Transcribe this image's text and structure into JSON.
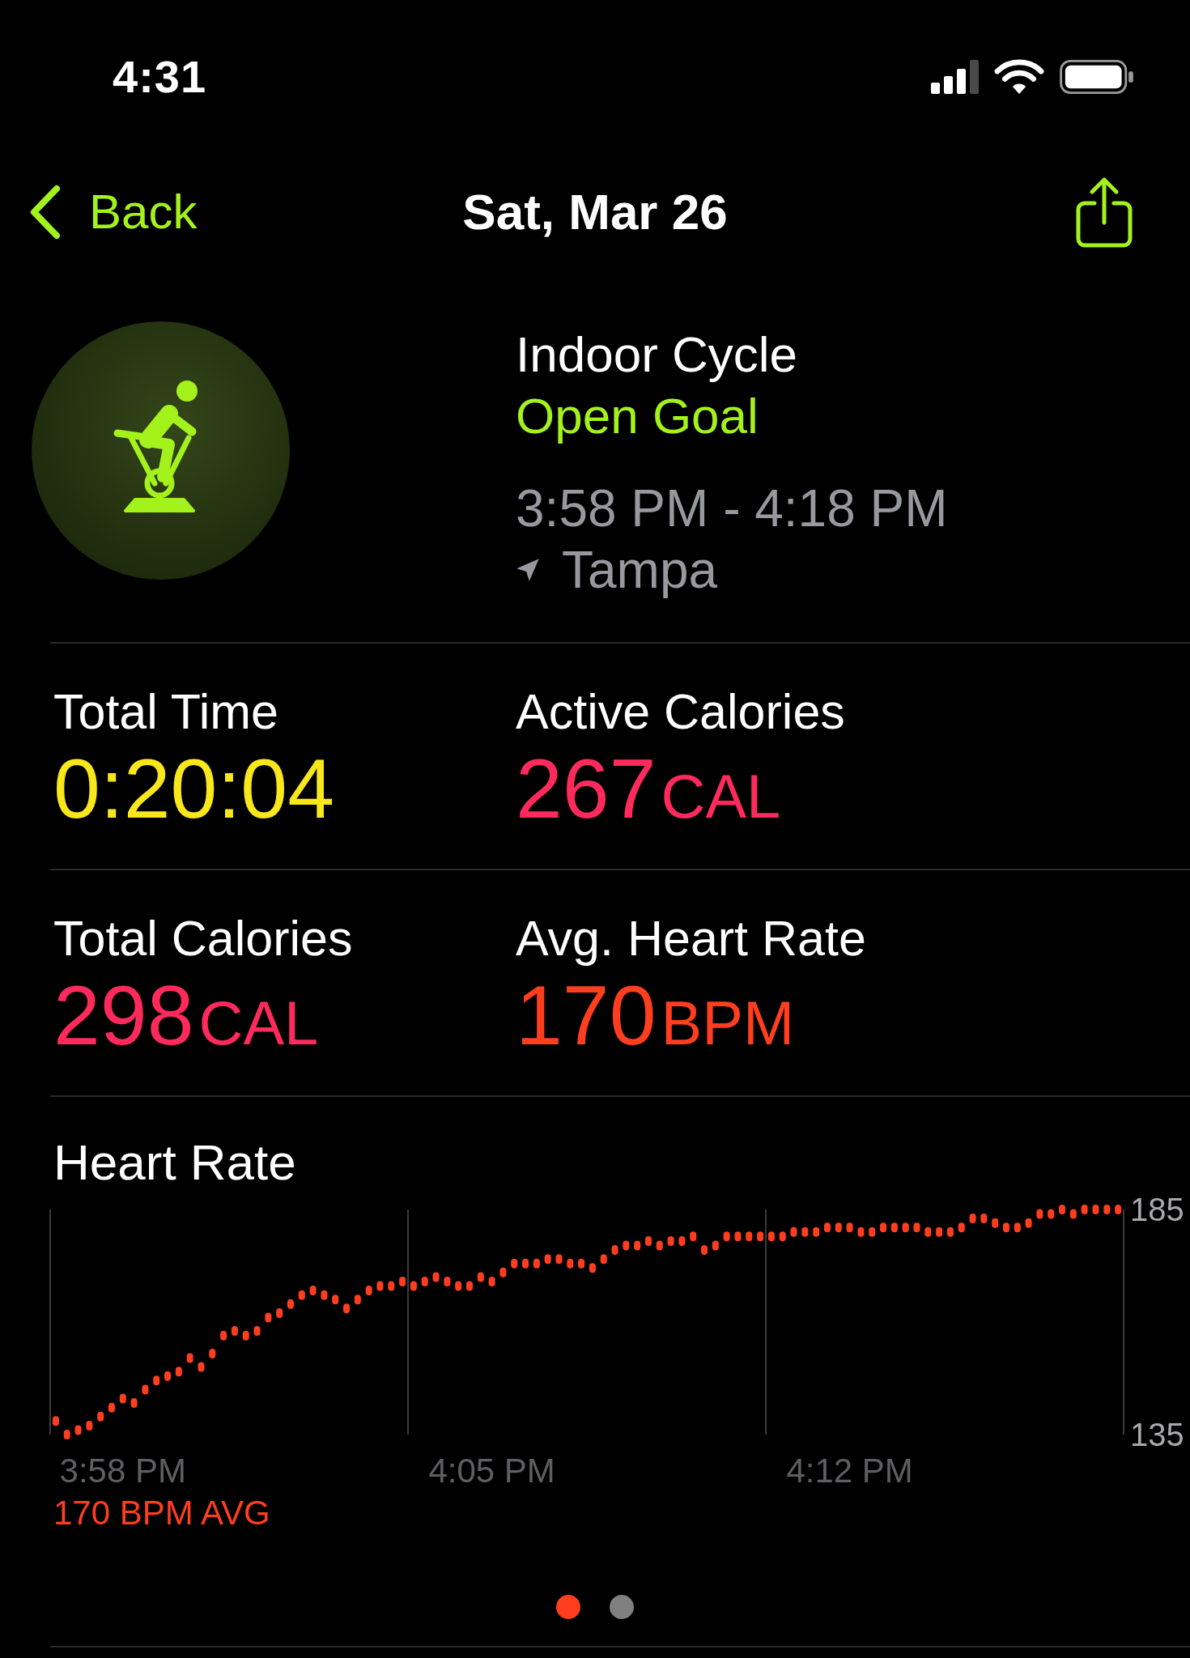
{
  "status_bar": {
    "time": "4:31"
  },
  "nav": {
    "back": "Back",
    "title": "Sat, Mar 26"
  },
  "workout": {
    "name": "Indoor Cycle",
    "goal": "Open Goal",
    "time_range": "3:58 PM - 4:18 PM",
    "location": "Tampa"
  },
  "stats": [
    {
      "label": "Total Time",
      "value": "0:20:04",
      "color": "#f7e71b"
    },
    {
      "label": "Active Calories",
      "value": "267",
      "unit": "CAL",
      "color": "#ff2a5c"
    },
    {
      "label": "Total Calories",
      "value": "298",
      "unit": "CAL",
      "color": "#ff2a5c"
    },
    {
      "label": "Avg. Heart Rate",
      "value": "170",
      "unit": "BPM",
      "color": "#ff3d1f"
    }
  ],
  "heart_rate": {
    "chart_data": {
      "type": "scatter",
      "title": "Heart Rate",
      "categories": [
        null,
        null,
        null,
        null,
        null,
        null,
        "3:58 PM",
        null,
        null,
        null,
        null,
        null,
        null,
        null,
        null,
        null,
        null,
        null,
        null,
        null,
        null,
        null,
        null,
        null,
        null,
        null,
        null,
        null,
        null,
        null,
        null,
        null,
        null,
        null,
        null,
        null,
        null,
        null,
        null,
        "4:05 PM",
        null,
        null,
        null,
        null,
        null,
        null,
        null,
        null,
        null,
        null,
        null,
        null,
        null,
        null,
        null,
        null,
        null,
        null,
        null,
        null,
        null,
        null,
        null,
        null,
        null,
        null,
        null,
        null,
        null,
        null,
        null,
        "4:12 PM",
        null,
        null,
        null,
        null,
        null,
        null,
        null,
        null,
        null,
        null,
        null,
        null,
        null,
        null,
        null,
        null,
        null,
        null,
        null,
        null,
        null,
        null,
        null,
        null
      ],
      "series": [
        {
          "color": "#ff3d1f",
          "values": [
            138,
            135,
            136,
            137,
            139,
            141,
            143,
            142,
            145,
            147,
            148,
            149,
            152,
            150,
            153,
            157,
            158,
            157,
            158,
            161,
            162,
            164,
            166,
            167,
            166,
            165,
            163,
            165,
            167,
            168,
            168,
            169,
            168,
            169,
            170,
            169,
            168,
            168,
            170,
            169,
            171,
            173,
            173,
            173,
            174,
            174,
            173,
            173,
            172,
            174,
            176,
            177,
            177,
            178,
            177,
            178,
            178,
            179,
            176,
            177,
            179,
            179,
            179,
            179,
            179,
            179,
            180,
            180,
            180,
            181,
            181,
            181,
            180,
            180,
            181,
            181,
            181,
            181,
            180,
            180,
            180,
            181,
            183,
            183,
            182,
            181,
            181,
            182,
            184,
            184,
            185,
            184,
            185,
            185,
            185,
            185
          ]
        }
      ],
      "ylim": [
        135,
        185
      ],
      "yticks": [
        135,
        185
      ]
    },
    "average": "170 BPM AVG"
  },
  "page_indicator": [
    {
      "selected": true
    },
    {
      "selected": false
    }
  ]
}
